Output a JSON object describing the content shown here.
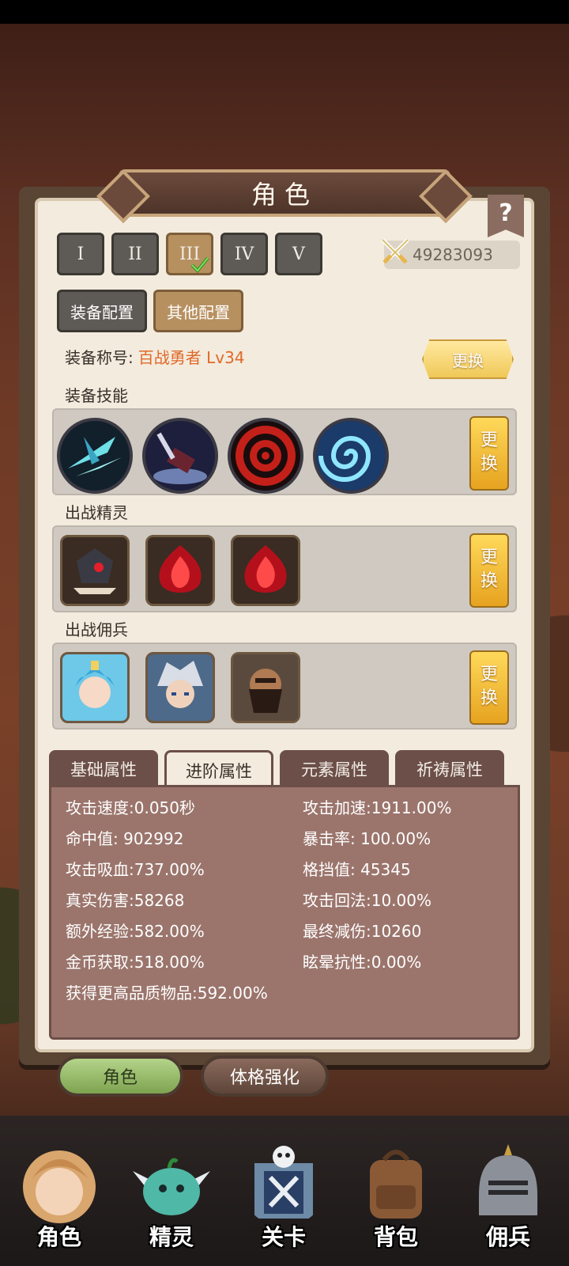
{
  "window": {
    "title": "角色",
    "help_label": "?"
  },
  "loadout_tabs": [
    {
      "label": "I"
    },
    {
      "label": "II"
    },
    {
      "label": "III"
    },
    {
      "label": "IV"
    },
    {
      "label": "V"
    }
  ],
  "selected_loadout": "III",
  "power": {
    "value": "49283093",
    "icon": "crossed-swords-icon"
  },
  "config_tabs": [
    {
      "label": "装备配置"
    },
    {
      "label": "其他配置"
    }
  ],
  "equipment_title": {
    "label": "装备称号:",
    "value": "百战勇者 Lv34",
    "change_label": "更换"
  },
  "sections": {
    "skills": {
      "label": "装备技能",
      "change_label": "更\n换"
    },
    "sprites": {
      "label": "出战精灵",
      "change_label": "更\n换"
    },
    "mercenaries": {
      "label": "出战佣兵",
      "change_label": "更\n换"
    }
  },
  "skills": [
    "ice-slash-skill-icon",
    "hammer-strike-skill-icon",
    "target-skill-icon",
    "whirlpool-skill-icon"
  ],
  "sprites": [
    "dark-sprite-icon",
    "red-flame-sprite-icon",
    "red-flame-sprite-icon"
  ],
  "mercenaries": [
    "elf-priestess-portrait",
    "silver-hair-warrior-portrait",
    "bearded-brute-portrait"
  ],
  "attribute_tabs": [
    {
      "label": "基础属性"
    },
    {
      "label": "进阶属性"
    },
    {
      "label": "元素属性"
    },
    {
      "label": "祈祷属性"
    }
  ],
  "active_attribute_tab": "进阶属性",
  "attributes": {
    "left": [
      "攻击速度:0.050秒",
      "命中值:   902992",
      "攻击吸血:737.00%",
      "真实伤害:58268",
      "额外经验:582.00%",
      "金币获取:518.00%"
    ],
    "right": [
      "攻击加速:1911.00%",
      "暴击率:   100.00%",
      "格挡值:    45345",
      "攻击回法:10.00%",
      "最终减伤:10260",
      "眩晕抗性:0.00%"
    ],
    "full": "获得更高品质物品:592.00%"
  },
  "bottom_tabs": [
    {
      "label": "角色"
    },
    {
      "label": "体格强化"
    }
  ],
  "nav": [
    {
      "label": "角色",
      "icon": "hero-portrait-icon"
    },
    {
      "label": "精灵",
      "icon": "slime-sprite-icon"
    },
    {
      "label": "关卡",
      "icon": "stage-skull-icon"
    },
    {
      "label": "背包",
      "icon": "backpack-icon"
    },
    {
      "label": "佣兵",
      "icon": "knight-helmet-icon"
    }
  ],
  "colors": {
    "accent_orange": "#e0692a",
    "gold_button": "#e6a320",
    "attr_panel": "#9b756c"
  }
}
